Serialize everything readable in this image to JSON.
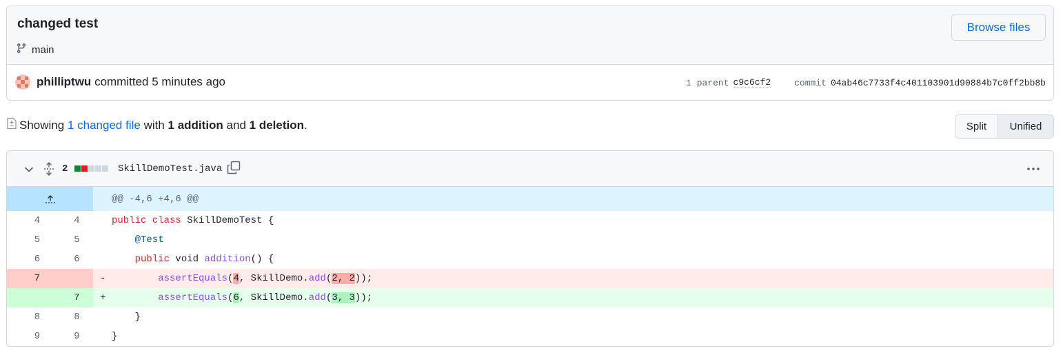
{
  "commit": {
    "title": "changed test",
    "branch": "main",
    "browse_label": "Browse files",
    "author": "philliptwu",
    "action_text": "committed 5 minutes ago",
    "parent_label": "1 parent",
    "parent_sha": "c9c6cf2",
    "commit_label": "commit",
    "commit_sha": "04ab46c7733f4c401103901d90884b7c0ff2bb8b"
  },
  "summary": {
    "prefix": "Showing",
    "changed_link": "1 changed file",
    "with": "with",
    "additions": "1 addition",
    "and": "and",
    "deletions": "1 deletion",
    "period": "."
  },
  "view_toggle": {
    "split": "Split",
    "unified": "Unified",
    "selected": "Unified"
  },
  "file": {
    "change_count": "2",
    "name": "SkillDemoTest.java",
    "blocks": [
      "#1a7f37",
      "#cf222e",
      "#d0d7de",
      "#d0d7de",
      "#d0d7de"
    ]
  },
  "diff": {
    "hunk_header": "@@ -4,6 +4,6 @@",
    "lines": [
      {
        "old": "4",
        "new": "4",
        "marker": "",
        "t0": "public",
        "t1": " ",
        "t2": "class",
        "t3": " SkillDemoTest {"
      },
      {
        "old": "5",
        "new": "5",
        "marker": "",
        "t0": "    ",
        "t1": "@Test"
      },
      {
        "old": "6",
        "new": "6",
        "marker": "",
        "t0": "    ",
        "t1": "public",
        "t2": " void ",
        "t3": "addition",
        "t4": "() {"
      },
      {
        "old": "7",
        "new": "",
        "marker": "-",
        "t0": "        ",
        "t1": "assertEquals",
        "t2": "(",
        "t3": "4",
        "t4": ", SkillDemo.",
        "t5": "add",
        "t6": "(",
        "t7": "2, 2",
        "t8": "));"
      },
      {
        "old": "",
        "new": "7",
        "marker": "+",
        "t0": "        ",
        "t1": "assertEquals",
        "t2": "(",
        "t3": "6",
        "t4": ", SkillDemo.",
        "t5": "add",
        "t6": "(",
        "t7": "3, 3",
        "t8": "));"
      },
      {
        "old": "8",
        "new": "8",
        "marker": "",
        "t0": "    }"
      },
      {
        "old": "9",
        "new": "9",
        "marker": "",
        "t0": "}"
      }
    ]
  },
  "colors": {
    "link": "#0969da",
    "deletion_bg": "#ffebe9",
    "addition_bg": "#e6ffec",
    "hunk_bg": "#ddf4ff"
  }
}
